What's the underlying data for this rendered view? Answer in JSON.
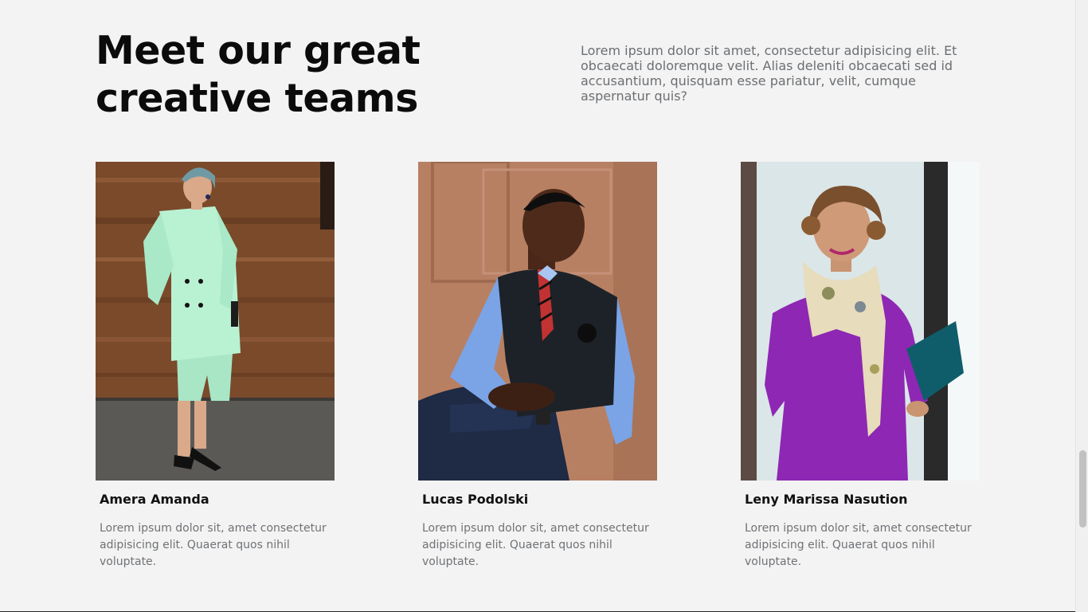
{
  "section": {
    "title_line1": "Meet our great",
    "title_line2": "creative teams",
    "intro": "Lorem ipsum dolor sit amet, consectetur adipisicing elit. Et obcaecati doloremque velit. Alias deleniti obcaecati sed id accusantium, quisquam esse pariatur, velit, cumque aspernatur quis?"
  },
  "team": [
    {
      "name": "Amera Amanda",
      "bio": "Lorem ipsum dolor sit, amet consectetur adipisicing elit. Quaerat quos nihil voluptate."
    },
    {
      "name": "Lucas Podolski",
      "bio": "Lorem ipsum dolor sit, amet consectetur adipisicing elit. Quaerat quos nihil voluptate."
    },
    {
      "name": "Leny Marissa Nasution",
      "bio": "Lorem ipsum dolor sit, amet consectetur adipisicing elit. Quaerat quos nihil voluptate."
    }
  ]
}
